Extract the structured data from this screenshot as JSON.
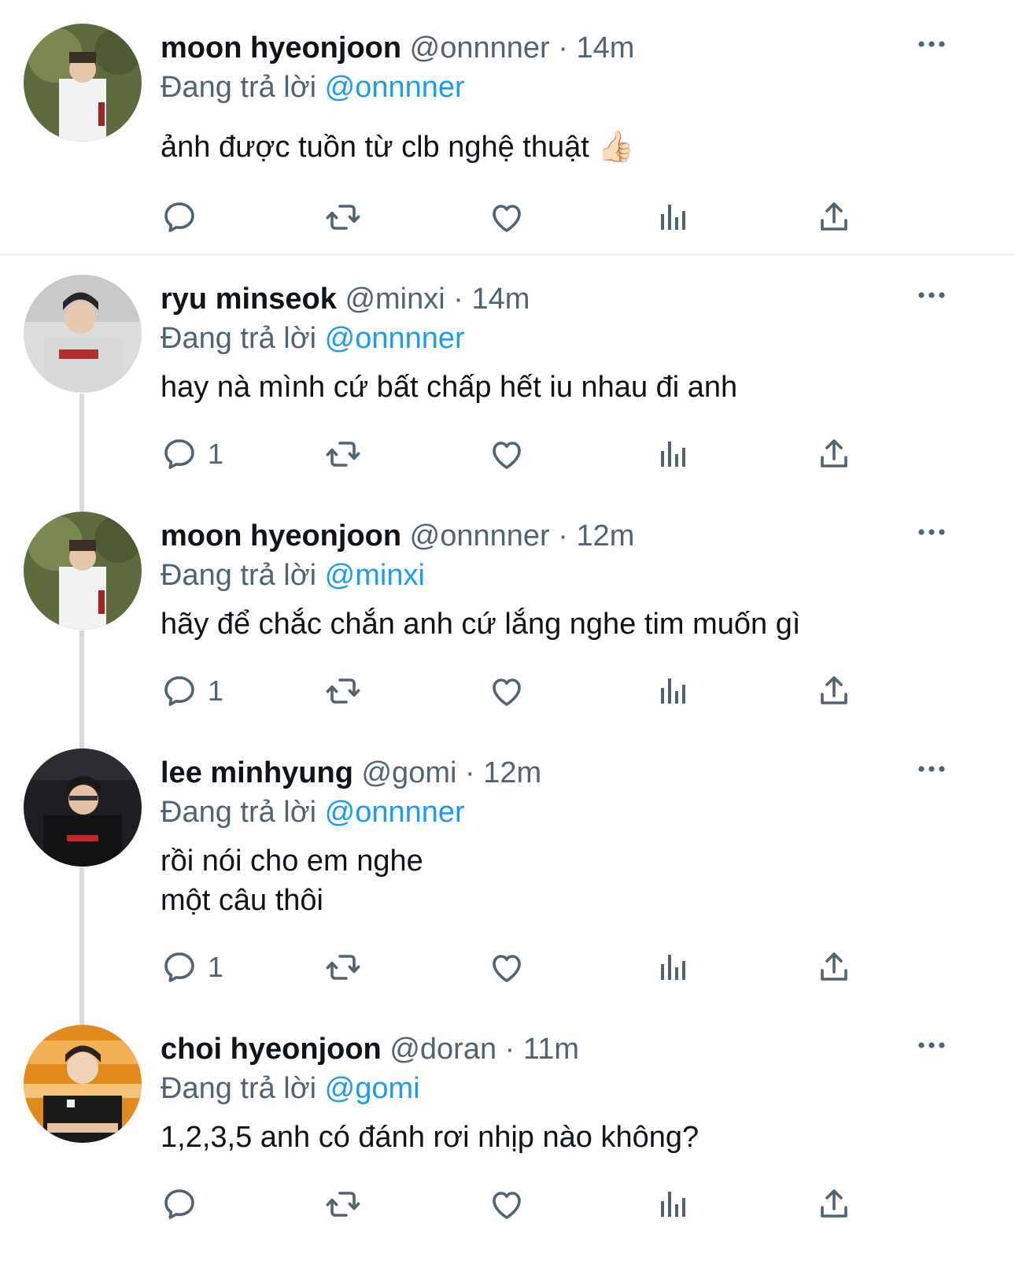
{
  "reply_prefix": "Đang trả lời",
  "icons": {
    "reply": "reply-icon",
    "retweet": "retweet-icon",
    "like": "like-icon",
    "views": "views-icon",
    "share": "share-icon",
    "more": "more-icon"
  },
  "colors": {
    "mention": "#1d9bf0",
    "secondary_text": "#536471",
    "icon": "#536471",
    "thread_line": "#d6dadd"
  },
  "tweets": [
    {
      "name": "moon hyeonjoon",
      "handle": "@onnnner",
      "separator": "·",
      "time": "14m",
      "reply_to": "@onnnner",
      "lines": [
        "ảnh được tuồn từ clb nghệ thuật 👍🏻"
      ],
      "reply_count": ""
    },
    {
      "name": "ryu minseok",
      "handle": "@minxi",
      "separator": "·",
      "time": "14m",
      "reply_to": "@onnnner",
      "lines": [
        "hay nà mình cứ bất chấp hết iu nhau đi anh"
      ],
      "reply_count": "1"
    },
    {
      "name": "moon hyeonjoon",
      "handle": "@onnnner",
      "separator": "·",
      "time": "12m",
      "reply_to": "@minxi",
      "lines": [
        "hãy để chắc chắn anh cứ lắng nghe tim muốn gì"
      ],
      "reply_count": "1"
    },
    {
      "name": "lee minhyung",
      "handle": "@gomi",
      "separator": "·",
      "time": "12m",
      "reply_to": "@onnnner",
      "lines": [
        "rồi nói cho em nghe",
        "một câu thôi"
      ],
      "reply_count": "1"
    },
    {
      "name": "choi hyeonjoon",
      "handle": "@doran",
      "separator": "·",
      "time": "11m",
      "reply_to": "@gomi",
      "lines": [
        "1,2,3,5 anh có đánh rơi nhịp nào không?"
      ],
      "reply_count": ""
    }
  ]
}
